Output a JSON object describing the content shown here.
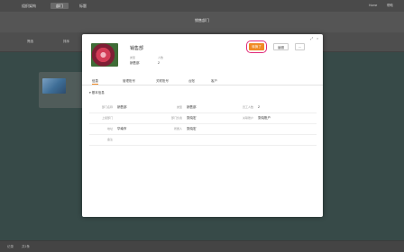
{
  "topbar": {
    "tabs": [
      "组织架构",
      "部门",
      "标题"
    ],
    "right": [
      "Home",
      "帮助"
    ]
  },
  "subbar": {
    "title": "销售部门"
  },
  "toolbar": {
    "items": [
      "筛选",
      "排序"
    ]
  },
  "footer": {
    "items": [
      "记录",
      "共1条"
    ]
  },
  "modal": {
    "window_controls": [
      "⤢",
      "×"
    ],
    "name": "销售部",
    "meta": [
      {
        "label": "类型",
        "value": "销售部"
      },
      {
        "label": "人数",
        "value": "2"
      }
    ],
    "buttons": {
      "primary": "转换了",
      "secondary": "编辑",
      "more": "···"
    },
    "tabs": [
      "信息",
      "管理账号",
      "关联账号",
      "台账",
      "客户"
    ],
    "section": "基本信息",
    "fields": {
      "r1": [
        {
          "label": "部门名称",
          "value": "销售部"
        },
        {
          "label": "类型",
          "value": "销售部"
        },
        {
          "label": "员工人数",
          "value": "2"
        }
      ],
      "r2": [
        {
          "label": "上级部门",
          "value": ""
        },
        {
          "label": "部门负责",
          "value": "张晓宏"
        },
        {
          "label": "关联账户",
          "value": "张晓账户"
        }
      ],
      "r3": [
        {
          "label": "地址",
          "value": "华南市"
        },
        {
          "label": "所属人",
          "value": "张晓宏"
        }
      ],
      "r4": [
        {
          "label": "备注",
          "value": ""
        }
      ]
    }
  },
  "colors": {
    "accent": "#f08a24",
    "highlight_ring": "#e02a7a"
  }
}
